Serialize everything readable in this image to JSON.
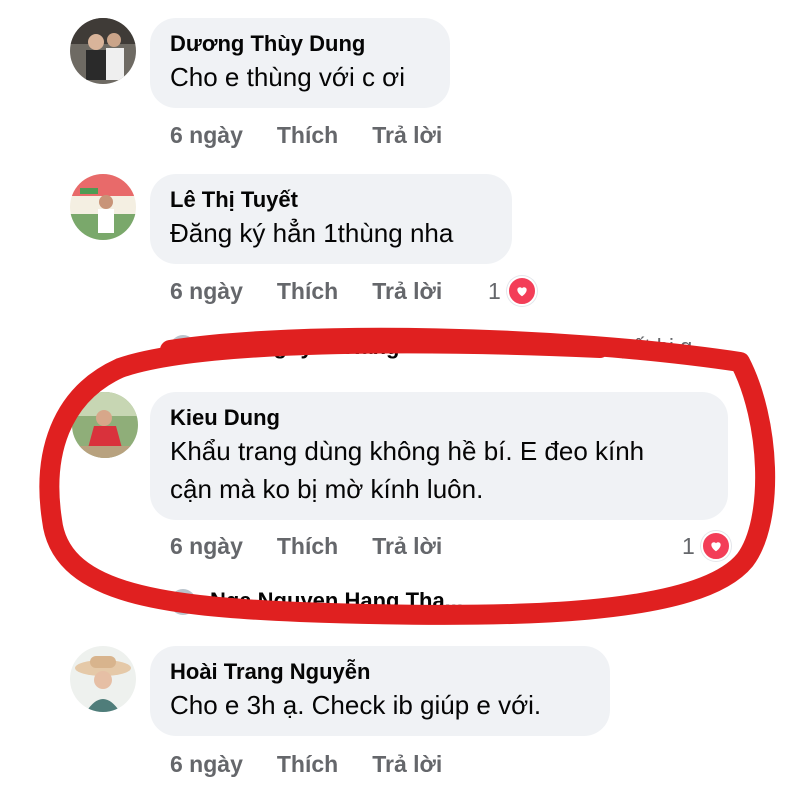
{
  "comments": [
    {
      "author": "Dương Thùy Dung",
      "text": "Cho e thùng với c ơi",
      "time": "6 ngày",
      "like": "Thích",
      "reply": "Trả lời"
    },
    {
      "author": "Lê Thị Tuyết",
      "text": "Đăng ký hẳn 1thùng nha",
      "time": "6 ngày",
      "like": "Thích",
      "reply": "Trả lời",
      "reaction_count": "1",
      "reaction_icon": "heart-icon"
    },
    {
      "author": "Kieu Dung",
      "text_line1": "Khẩu trang dùng không hề bí. E đeo kính",
      "text_line2": "cận mà ko bị mờ kính luôn.",
      "time": "6 ngày",
      "like": "Thích",
      "reply": "Trả lời",
      "reaction_count": "1",
      "reaction_icon": "heart-icon"
    },
    {
      "author": "Hoài Trang Nguyễn",
      "text": "Cho e 3h ạ. Check ib giúp e với.",
      "time": "6 ngày",
      "like": "Thích",
      "reply": "Trả lời"
    }
  ],
  "partial_replies": [
    {
      "author": "Nga Nguyen Hang",
      "snippet": "Lê Thị Tuyết bị g..."
    },
    {
      "author": "Nga Nguyen Hang Tha..."
    }
  ],
  "colors": {
    "bubble": "#f0f2f5",
    "meta_text": "#65676b",
    "heart": "#f33e58",
    "annotation": "#e02020"
  }
}
